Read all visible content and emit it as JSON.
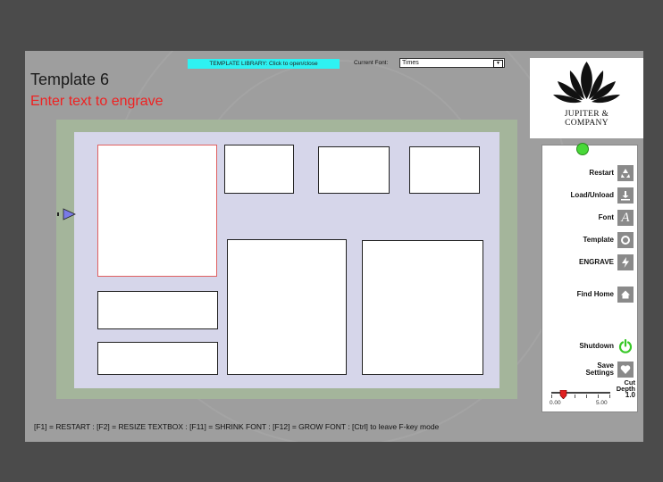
{
  "header": {
    "template_title": "Template 6",
    "prompt": "Enter text to engrave",
    "library_button": "TEMPLATE LIBRARY: Click to open/close",
    "font_label": "Current Font:",
    "font_value": "Times"
  },
  "logo": {
    "line1": "JUPITER &",
    "line2": "COMPANY"
  },
  "panel": {
    "restart": "Restart",
    "load": "Load/Unload",
    "font": "Font",
    "template": "Template",
    "engrave": "ENGRAVE",
    "find_home": "Find Home",
    "shutdown": "Shutdown",
    "save_line1": "Save",
    "save_line2": "Settings",
    "cut_depth_line1": "Cut",
    "cut_depth_line2": "Depth",
    "cut_depth_value": "1.0",
    "slider_min": "0.00",
    "slider_max": "5.00",
    "slider_level": 0.2
  },
  "footer": {
    "hotkeys": "[F1] = RESTART : [F2] = RESIZE TEXTBOX : [F11] = SHRINK FONT : [F12] = GROW FONT : [Ctrl] to leave F-key mode"
  },
  "colors": {
    "accent_cyan": "#2ef2f2",
    "prompt_red": "#ee2222",
    "status_green": "#48d838"
  }
}
